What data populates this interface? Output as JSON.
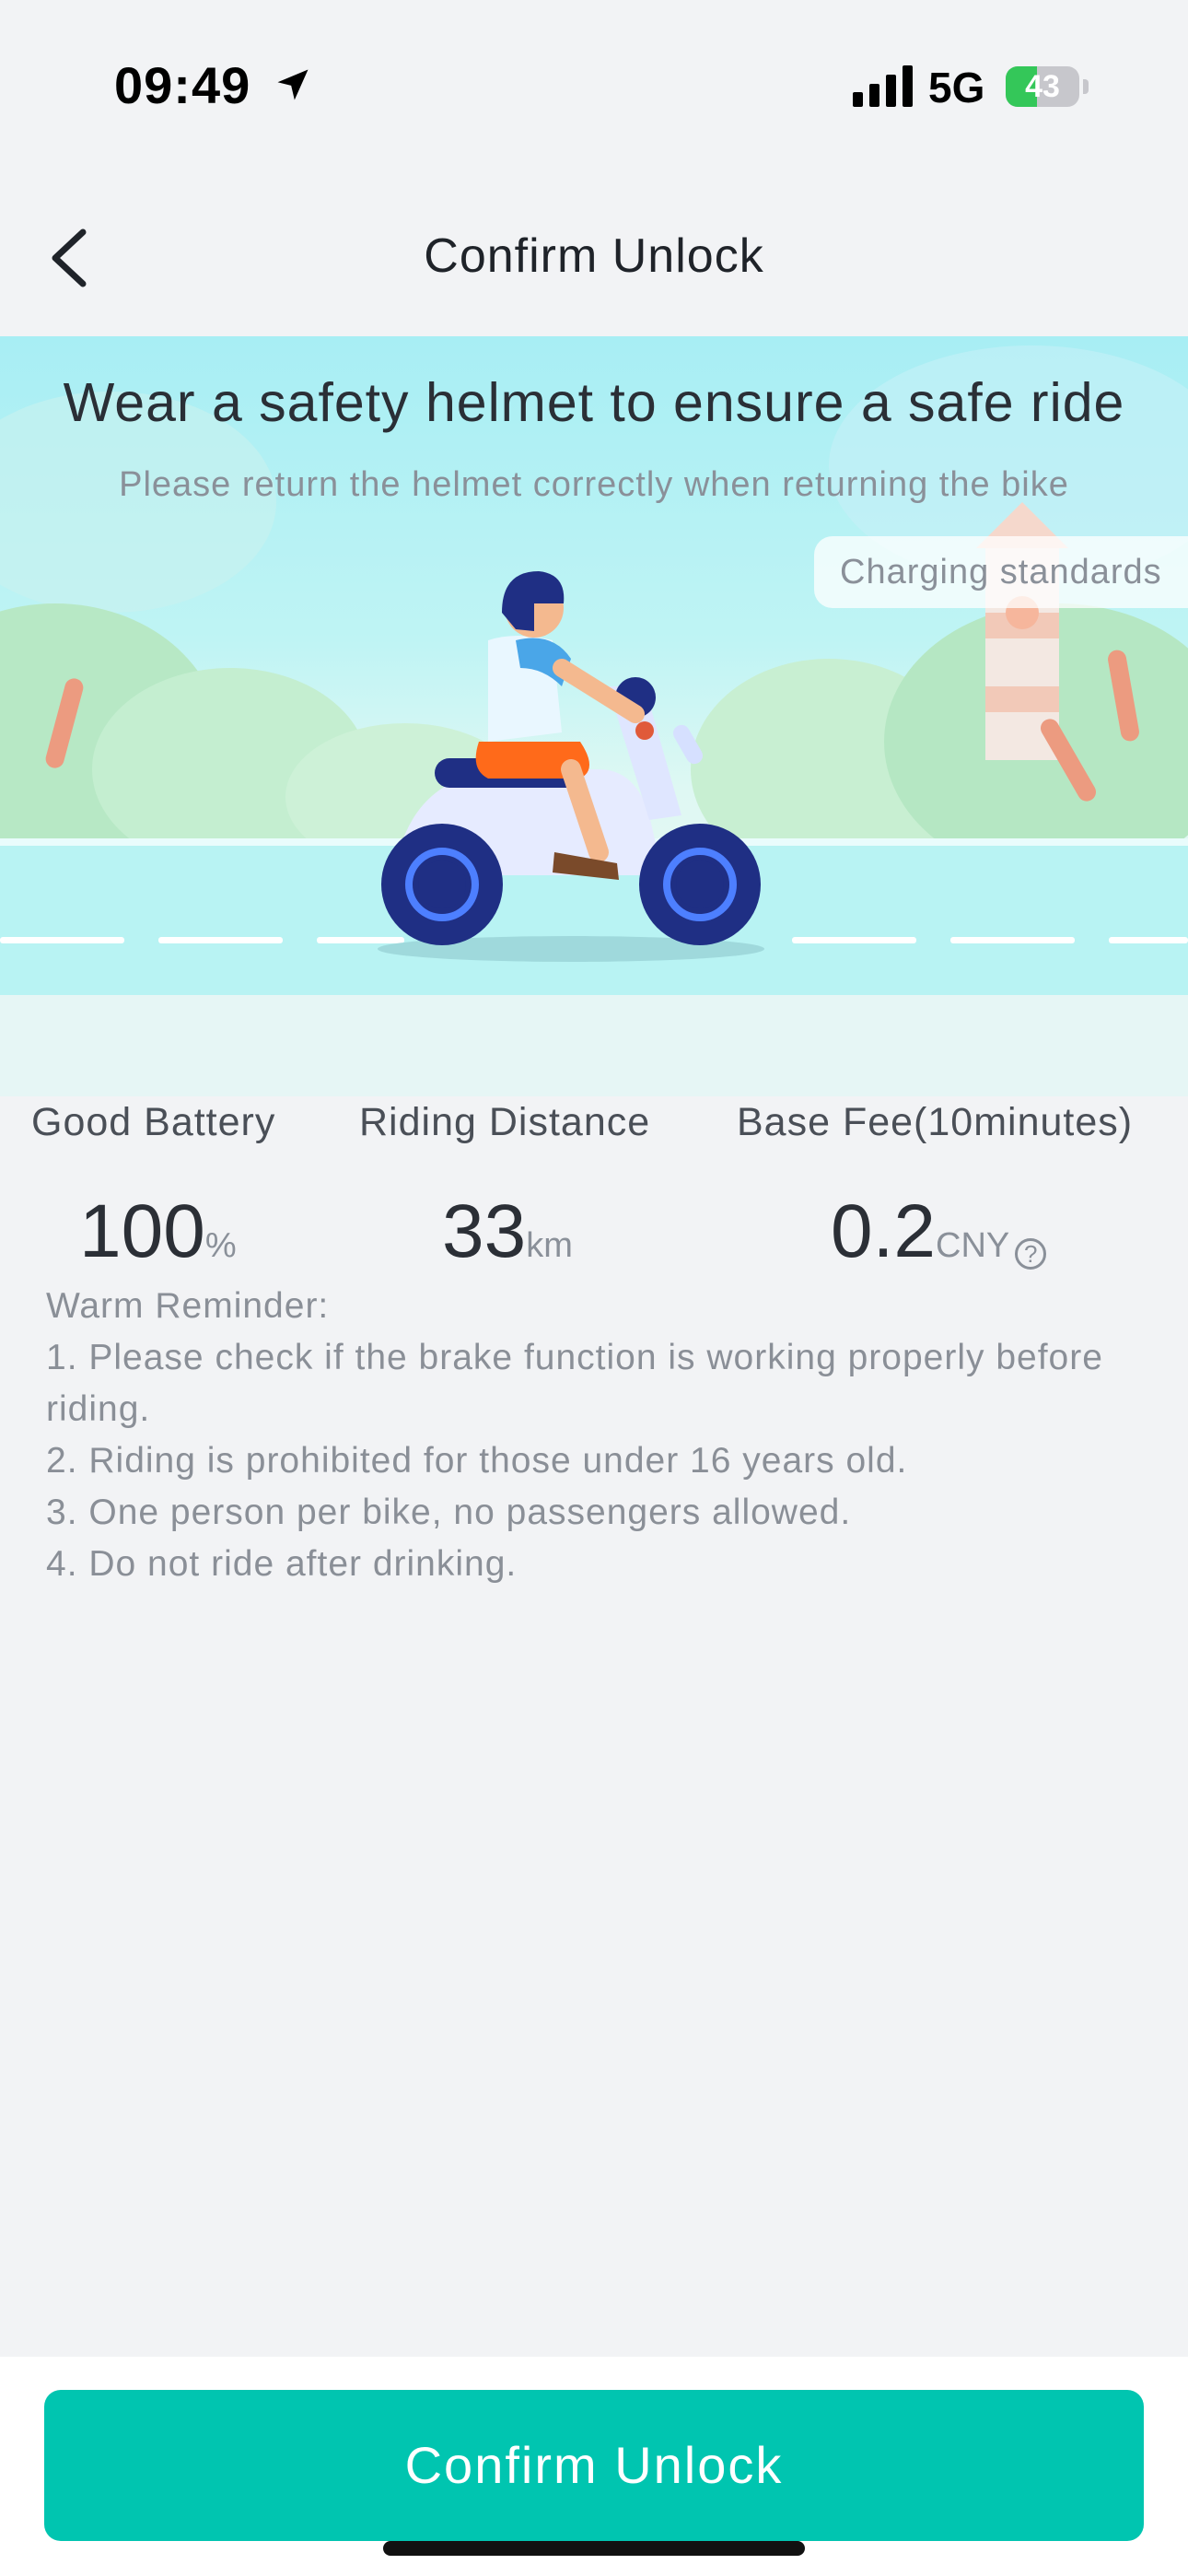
{
  "status_bar": {
    "time": "09:49",
    "network": "5G",
    "battery_level": "43",
    "battery_fraction": 0.43
  },
  "nav": {
    "title": "Confirm Unlock"
  },
  "hero": {
    "title": "Wear a safety helmet to ensure a safe ride",
    "subtitle": "Please return the helmet correctly when returning the bike",
    "charging_link": "Charging standards"
  },
  "stats": {
    "battery_label": "Good Battery",
    "battery_value": "100",
    "battery_unit": "%",
    "distance_label": "Riding Distance",
    "distance_value": "33",
    "distance_unit": "km",
    "fee_label": "Base Fee(10minutes)",
    "fee_value": "0.2",
    "fee_unit": "CNY"
  },
  "reminder": {
    "heading": "Warm Reminder:",
    "items": [
      "1. Please check if the brake function is working properly before riding.",
      "2. Riding is prohibited for those under 16 years old.",
      "3. One person per bike, no passengers allowed.",
      "4. Do not ride after drinking."
    ]
  },
  "footer": {
    "confirm_label": "Confirm Unlock"
  },
  "colors": {
    "accent": "#00c5b0",
    "battery_green": "#34c759",
    "background": "#f2f3f5"
  }
}
